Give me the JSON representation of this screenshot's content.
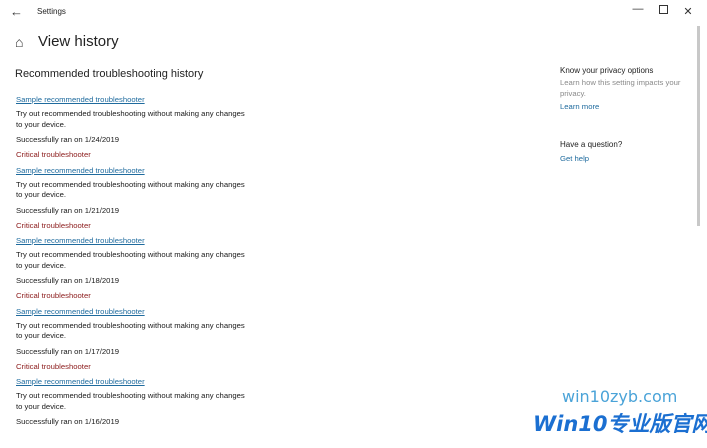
{
  "window": {
    "title": "Settings",
    "back_icon": "back-arrow-icon",
    "controls": [
      "minimize",
      "maximize",
      "close"
    ]
  },
  "header": {
    "home_icon": "home-icon",
    "title": "View history"
  },
  "main": {
    "section_title": "Recommended troubleshooting history",
    "items": [
      {
        "link": "Sample recommended troubleshooter",
        "description": "Try out recommended troubleshooting without making any changes to your device.",
        "status": "Successfully ran on 1/24/2019",
        "type": "Critical troubleshooter"
      },
      {
        "link": "Sample recommended troubleshooter",
        "description": "Try out recommended troubleshooting without making any changes to your device.",
        "status": "Successfully ran on 1/21/2019",
        "type": "Critical troubleshooter"
      },
      {
        "link": "Sample recommended troubleshooter",
        "description": "Try out recommended troubleshooting without making any changes to your device.",
        "status": "Successfully ran on 1/18/2019",
        "type": "Critical troubleshooter"
      },
      {
        "link": "Sample recommended troubleshooter",
        "description": "Try out recommended troubleshooting without making any changes to your device.",
        "status": "Successfully ran on 1/17/2019",
        "type": "Critical troubleshooter"
      },
      {
        "link": "Sample recommended troubleshooter",
        "description": "Try out recommended troubleshooting without making any changes to your device.",
        "status": "Successfully ran on 1/16/2019",
        "type": ""
      }
    ]
  },
  "sidebar": {
    "privacy": {
      "title": "Know your privacy options",
      "description": "Learn how this setting impacts your privacy.",
      "link": "Learn more"
    },
    "question": {
      "title": "Have a question?",
      "link": "Get help"
    }
  },
  "watermark": {
    "site": "win10zyb.com",
    "logo": "Win10专业版官网"
  },
  "colors": {
    "link": "#1f6b9e",
    "critical": "#8b1a1a",
    "muted": "#8a8a8a"
  }
}
